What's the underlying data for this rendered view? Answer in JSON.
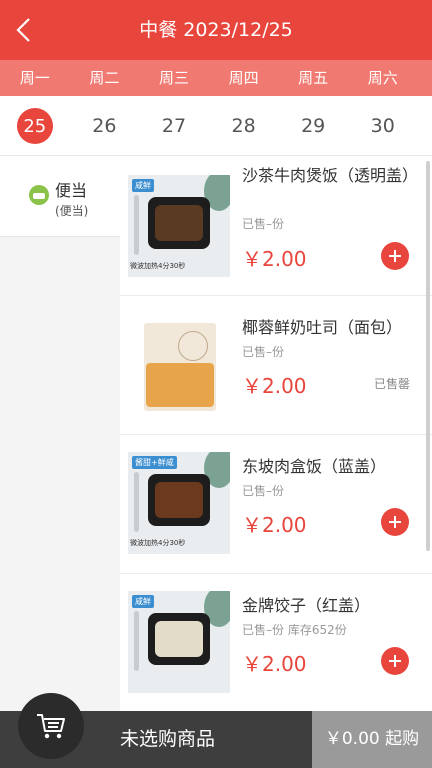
{
  "header": {
    "title": "中餐 2023/12/25"
  },
  "weekdays": [
    "周一",
    "周二",
    "周三",
    "周四",
    "周五",
    "周六"
  ],
  "dates": [
    "25",
    "26",
    "27",
    "28",
    "29",
    "30"
  ],
  "sidebar": {
    "category": {
      "name": "便当",
      "sub": "(便当)",
      "icon": "bento-icon"
    }
  },
  "items": [
    {
      "name": "沙茶牛肉煲饭（透明盖）",
      "meta": "已售–份",
      "price": "￥2.00",
      "tag": "咸鲜",
      "tip": "微波加热4分30秒",
      "action": "add"
    },
    {
      "name": "椰蓉鲜奶吐司（面包）",
      "meta": "已售–份",
      "price": "￥2.00",
      "status": "已售罄"
    },
    {
      "name": "东坡肉盒饭（蓝盖）",
      "meta": "已售–份",
      "price": "￥2.00",
      "tag": "酱甜+鲜咸",
      "tip": "微波加热4分30秒",
      "action": "add"
    },
    {
      "name": "金牌饺子（红盖）",
      "meta": "已售–份   库存652份",
      "price": "￥2.00",
      "tag": "咸鲜",
      "action": "add"
    }
  ],
  "footer": {
    "cart_text": "未选购商品",
    "checkout": "￥0.00 起购"
  },
  "colors": {
    "accent": "#e8453c",
    "weekday_bar": "#f07a72",
    "footer": "#3e3e3e",
    "checkout": "#9a9a9a"
  }
}
